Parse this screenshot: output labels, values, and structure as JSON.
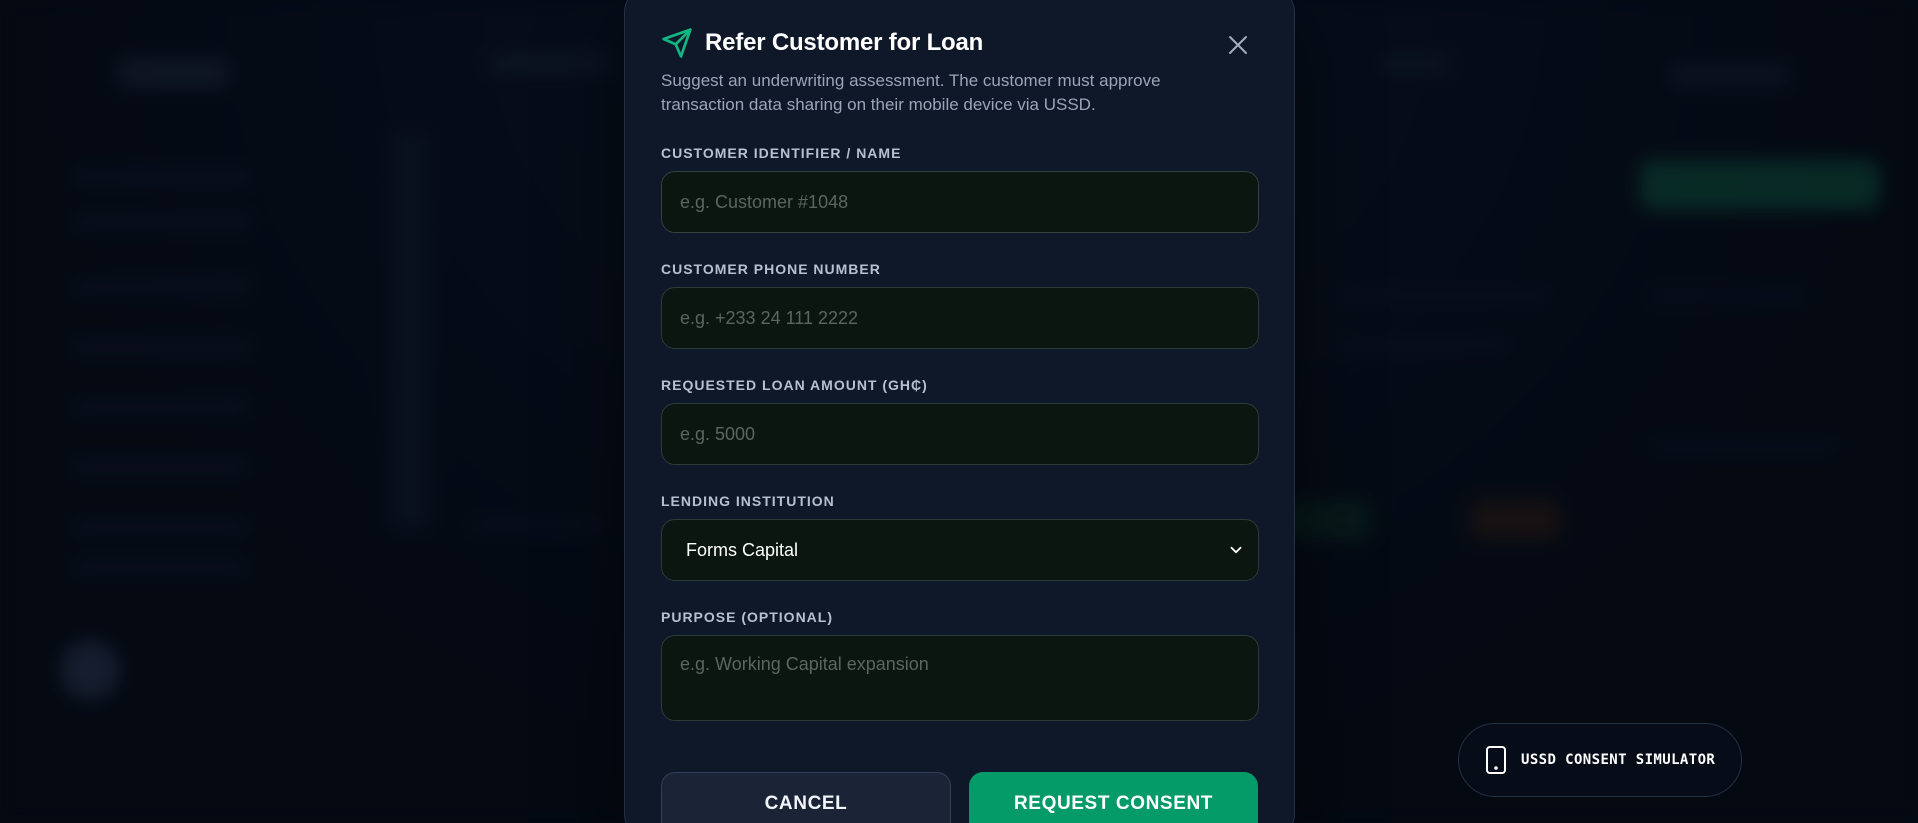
{
  "modal": {
    "title": "Refer Customer for Loan",
    "description": "Suggest an underwriting assessment. The customer must approve transaction data sharing on their mobile device via USSD.",
    "fields": {
      "customer_identifier": {
        "label": "Customer Identifier / Name",
        "placeholder": "e.g. Customer #1048",
        "value": ""
      },
      "phone": {
        "label": "Customer Phone Number",
        "placeholder": "e.g. +233 24 111 2222",
        "value": ""
      },
      "loan_amount": {
        "label": "Requested Loan Amount (GH₵)",
        "placeholder": "e.g. 5000",
        "value": ""
      },
      "institution": {
        "label": "Lending Institution",
        "selected": "Forms Capital"
      },
      "purpose": {
        "label": "Purpose (Optional)",
        "placeholder": "e.g. Working Capital expansion",
        "value": ""
      }
    },
    "actions": {
      "cancel_label": "Cancel",
      "submit_label": "Request Consent"
    }
  },
  "ussd_simulator": {
    "label": "USSD CONSENT SIMULATOR"
  },
  "colors": {
    "accent": "#10b981",
    "primary_button": "#059b69",
    "modal_bg": "#0f1829",
    "input_bg": "#0a160f"
  },
  "icons": {
    "title_icon": "send-icon",
    "close_icon": "close-icon",
    "select_icon": "chevron-down-icon",
    "ussd_icon": "smartphone-icon"
  }
}
